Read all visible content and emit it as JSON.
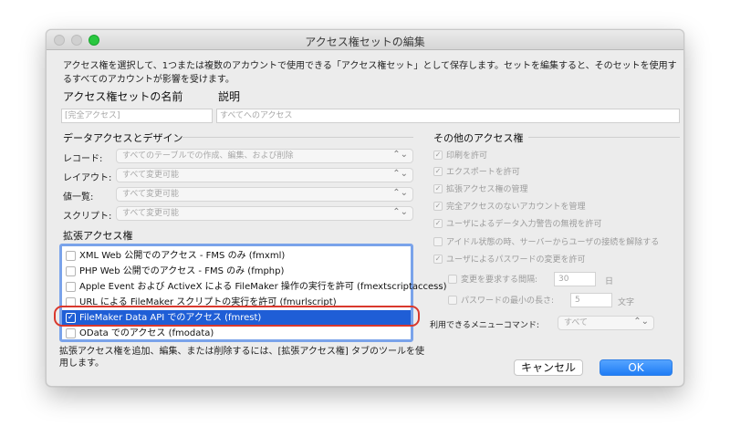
{
  "window": {
    "title": "アクセス権セットの編集"
  },
  "description": "アクセス権を選択して、1つまたは複数のアカウントで使用できる「アクセス権セット」として保存します。セットを編集すると、そのセットを使用するすべてのアカウントが影響を受けます。",
  "name_label": "アクセス権セットの名前",
  "name_value": "[完全アクセス]",
  "desc_label": "説明",
  "desc_value": "すべてへのアクセス",
  "data_section": {
    "title": "データアクセスとデザイン",
    "rows": [
      {
        "label": "レコード:",
        "value": "すべてのテーブルでの作成、編集、および削除"
      },
      {
        "label": "レイアウト:",
        "value": "すべて変更可能"
      },
      {
        "label": "値一覧:",
        "value": "すべて変更可能"
      },
      {
        "label": "スクリプト:",
        "value": "すべて変更可能"
      }
    ]
  },
  "ext_section": {
    "title": "拡張アクセス権",
    "items": [
      {
        "label": "XML Web 公開でのアクセス - FMS のみ (fmxml)",
        "checked": false
      },
      {
        "label": "PHP Web 公開でのアクセス - FMS のみ (fmphp)",
        "checked": false
      },
      {
        "label": "Apple Event および ActiveX による FileMaker 操作の実行を許可 (fmextscriptaccess)",
        "checked": false
      },
      {
        "label": "URL による FileMaker スクリプトの実行を許可 (fmurlscript)",
        "checked": false
      },
      {
        "label": "FileMaker Data API でのアクセス (fmrest)",
        "checked": true
      },
      {
        "label": "OData でのアクセス (fmodata)",
        "checked": false
      }
    ],
    "note": "拡張アクセス権を追加、編集、または削除するには、[拡張アクセス権] タブのツールを使用します。"
  },
  "other_section": {
    "title": "その他のアクセス権",
    "items": [
      {
        "label": "印刷を許可",
        "checked": true
      },
      {
        "label": "エクスポートを許可",
        "checked": true
      },
      {
        "label": "拡張アクセス権の管理",
        "checked": true
      },
      {
        "label": "完全アクセスのないアカウントを管理",
        "checked": true
      },
      {
        "label": "ユーザによるデータ入力警告の無視を許可",
        "checked": true
      },
      {
        "label": "アイドル状態の時、サーバーからユーザの接続を解除する",
        "checked": false
      },
      {
        "label": "ユーザによるパスワードの変更を許可",
        "checked": true
      }
    ],
    "change_interval": {
      "label": "変更を要求する間隔:",
      "value": "30",
      "unit": "日"
    },
    "min_length": {
      "label": "パスワードの最小の長さ:",
      "value": "5",
      "unit": "文字"
    },
    "menu_label": "利用できるメニューコマンド:",
    "menu_value": "すべて"
  },
  "buttons": {
    "cancel": "キャンセル",
    "ok": "OK"
  },
  "icons": {
    "check": "checkmark-icon",
    "updown": "up-down-arrows-icon"
  },
  "colors": {
    "selection": "#1f5ed6",
    "accent_ok": "#1f7cf5",
    "highlight_ring": "#d9382d"
  }
}
